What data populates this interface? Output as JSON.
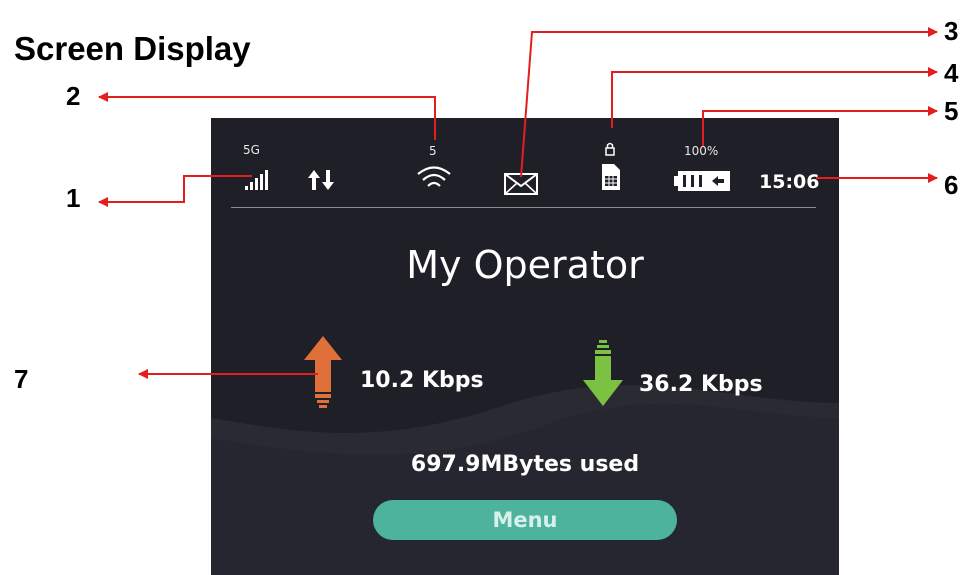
{
  "title": "Screen Display",
  "callouts": [
    "1",
    "2",
    "3",
    "4",
    "5",
    "6",
    "7"
  ],
  "colors": {
    "leader": "#e41e1e",
    "screen_bg": "#1f1f27",
    "upload_arrow": "#e0703a",
    "download_arrow": "#7cc242",
    "menu_button": "#4db39c"
  },
  "status_bar": {
    "network_type": "5G",
    "wifi_clients": "5",
    "battery_level": "100%",
    "time": "15:06",
    "icons": [
      "signal-strength-icon",
      "data-transfer-icon",
      "wifi-icon",
      "message-icon",
      "sim-lock-icon",
      "battery-icon"
    ]
  },
  "operator_name": "My Operator",
  "upload_rate": "10.2 Kbps",
  "download_rate": "36.2 Kbps",
  "data_usage": "697.9MBytes used",
  "menu_label": "Menu"
}
